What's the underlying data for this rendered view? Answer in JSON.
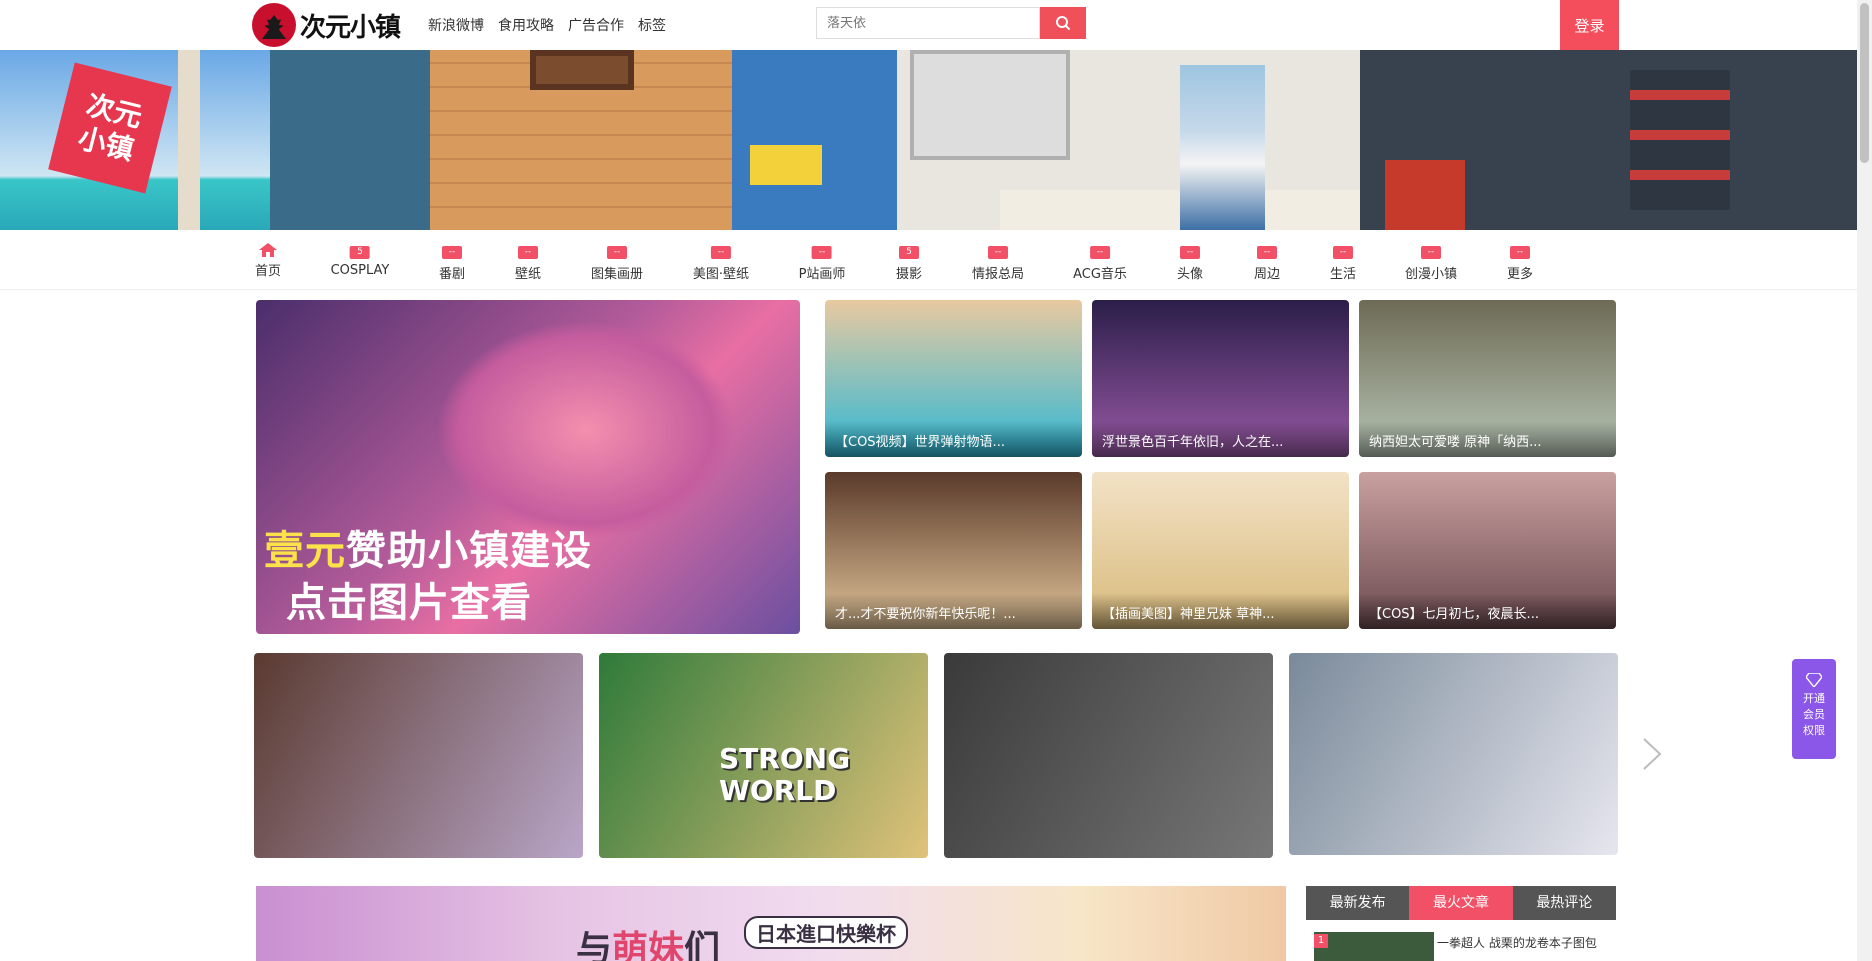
{
  "header": {
    "logo_text": "次元小镇",
    "nav": [
      "新浪微博",
      "食用攻略",
      "广告合作",
      "标签"
    ],
    "search_placeholder": "落天依",
    "login_label": "登录"
  },
  "banner": {
    "stamp_text": "次元\n小镇"
  },
  "categories": [
    {
      "label": "首页",
      "badge": null
    },
    {
      "label": "COSPLAY",
      "badge": "5"
    },
    {
      "label": "番剧",
      "badge": "--"
    },
    {
      "label": "壁纸",
      "badge": "--"
    },
    {
      "label": "图集画册",
      "badge": "--"
    },
    {
      "label": "美图·壁纸",
      "badge": "--"
    },
    {
      "label": "P站画师",
      "badge": "--"
    },
    {
      "label": "摄影",
      "badge": "5"
    },
    {
      "label": "情报总局",
      "badge": "--"
    },
    {
      "label": "ACG音乐",
      "badge": "--"
    },
    {
      "label": "头像",
      "badge": "--"
    },
    {
      "label": "周边",
      "badge": "--"
    },
    {
      "label": "生活",
      "badge": "--"
    },
    {
      "label": "创漫小镇",
      "badge": "--"
    },
    {
      "label": "更多",
      "badge": "--"
    }
  ],
  "feature": {
    "line1_highlight": "壹元",
    "line1_rest": "赞助小镇建设",
    "line2": "点击图片查看"
  },
  "thumbs": [
    {
      "caption": "【COS视频】世界弹射物语...",
      "colors": [
        "#e8c9a0",
        "#2fb8d6"
      ]
    },
    {
      "caption": "浮世景色百千年依旧，人之在...",
      "colors": [
        "#2b1e4a",
        "#9a5aa6"
      ]
    },
    {
      "caption": "纳西妲太可爱喽 原神「纳西...",
      "colors": [
        "#6d6a55",
        "#b8c6b6"
      ]
    },
    {
      "caption": "才...才不要祝你新年快乐呢！...",
      "colors": [
        "#5a3a2a",
        "#e3c59a"
      ]
    },
    {
      "caption": "【插画美图】神里兄妹 草神...",
      "colors": [
        "#f2e2c6",
        "#d8b97a"
      ]
    },
    {
      "caption": "【COS】七月初七，夜晨长...",
      "colors": [
        "#c9a0a0",
        "#6b4a4f"
      ]
    }
  ],
  "slides": [
    {
      "colors": [
        "#5a3a30",
        "#b9a6c8"
      ]
    },
    {
      "colors": [
        "#2f7a3a",
        "#e0c27a"
      ],
      "text": "STRONG\nWORLD"
    },
    {
      "colors": [
        "#3a3a3a",
        "#777777"
      ]
    },
    {
      "colors": [
        "#7a8a9a",
        "#e6e6ee"
      ]
    }
  ],
  "vip": {
    "label": "开通\n会员\n权限"
  },
  "promo": {
    "title_a": "与",
    "title_m": "萌妹",
    "title_b": "们",
    "badge_text": "日本進口快樂杯"
  },
  "sidebar_tabs": [
    {
      "label": "最新发布",
      "active": false
    },
    {
      "label": "最火文章",
      "active": true
    },
    {
      "label": "最热评论",
      "active": false
    }
  ],
  "top_post": {
    "rank": "1",
    "title": "一拳超人 战栗的龙卷本子图包"
  }
}
